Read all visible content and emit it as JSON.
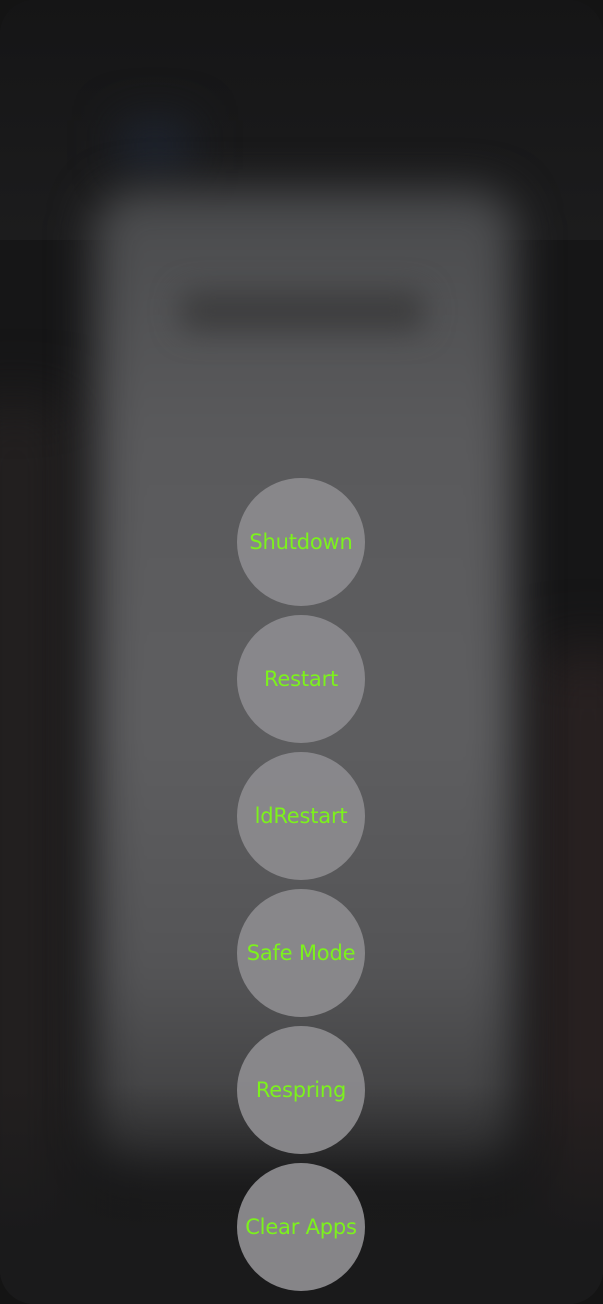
{
  "power_menu": {
    "buttons": [
      {
        "label": "Shutdown"
      },
      {
        "label": "Restart"
      },
      {
        "label": "ldRestart"
      },
      {
        "label": "Safe Mode"
      },
      {
        "label": "Respring"
      },
      {
        "label": "Clear Apps"
      }
    ]
  },
  "colors": {
    "button_text": "#7cf21c",
    "button_fill": "#8a898d"
  }
}
